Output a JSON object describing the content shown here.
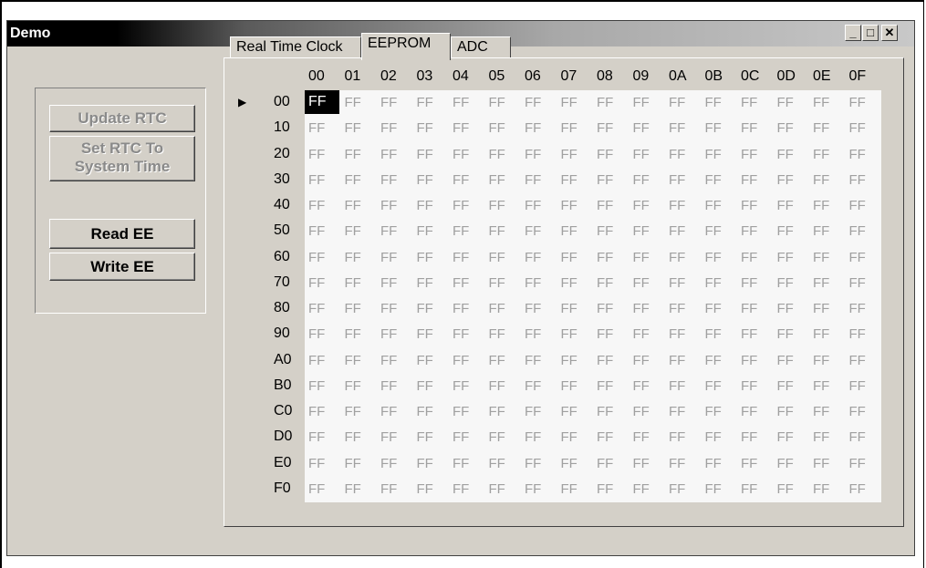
{
  "window": {
    "title": "Demo",
    "minimize": "_",
    "maximize": "□",
    "close": "✕"
  },
  "tabs": [
    "Real Time Clock",
    "EEPROM",
    "ADC"
  ],
  "active_tab": "EEPROM",
  "buttons": {
    "update_rtc": "Update RTC",
    "set_rtc_line1": "Set RTC To",
    "set_rtc_line2": "System Time",
    "read_ee": "Read EE",
    "write_ee": "Write EE"
  },
  "grid": {
    "columns": [
      "00",
      "01",
      "02",
      "03",
      "04",
      "05",
      "06",
      "07",
      "08",
      "09",
      "0A",
      "0B",
      "0C",
      "0D",
      "0E",
      "0F"
    ],
    "rows": [
      "00",
      "10",
      "20",
      "30",
      "40",
      "50",
      "60",
      "70",
      "80",
      "90",
      "A0",
      "B0",
      "C0",
      "D0",
      "E0",
      "F0"
    ],
    "cell_value": "FF",
    "row_pointer": "▶"
  }
}
